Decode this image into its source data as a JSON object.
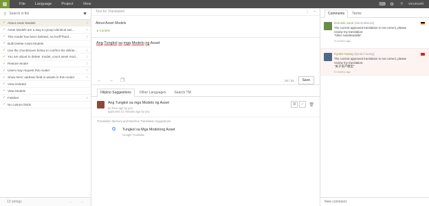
{
  "topbar": {
    "menu": [
      "File",
      "Language",
      "Project",
      "View"
    ],
    "user": "vnrumzett"
  },
  "left": {
    "search_placeholder": "Search in file",
    "strings": [
      {
        "text": "About Asset Models",
        "active": true,
        "comment": true
      },
      {
        "text": "Asset Models are a way to group identical ass...",
        "comment": true
      },
      {
        "text": "This model has been deleted, na hreff\"/hard...",
        "comment": true
      },
      {
        "text": "Bulk Delete Asset Models",
        "comment": false
      },
      {
        "text": "Use the checkboxes below to confirm the delete...",
        "comment": true
      },
      {
        "text": "You are about to delete :model_count asset mod...",
        "comment": true
      },
      {
        "text": "Restore Model",
        "comment": true
      },
      {
        "text": "Users may request this model",
        "comment": true
      },
      {
        "text": "Show MAC address field in assets in this model",
        "comment": true
      },
      {
        "text": "View Deleted",
        "comment": false
      },
      {
        "text": "View Models",
        "comment": false
      },
      {
        "text": "Fieldset",
        "comment": true
      },
      {
        "text": "No custom fields",
        "comment": false
      }
    ],
    "count": "13 strings"
  },
  "center": {
    "source_header": "Text for Translation",
    "source_text": "About Asset Models",
    "context_label": "▸ Context",
    "translation_words": [
      "Ang",
      "Tungkol",
      "sa",
      "mga",
      "Modelo",
      "ng",
      "Asset"
    ],
    "char_count": "18 / 34",
    "save_label": "Save",
    "tabs": [
      "Filipino Suggestions",
      "Other Languages",
      "Search TM"
    ],
    "suggestion": {
      "text": "Ang Tungkol sa mga Modelo ng Asset",
      "meta1": "an hour ago by you",
      "meta2": "approved 21 minutes ago by you",
      "votes": "0"
    },
    "tm_caption": "Translation Memory and Machine Translation suggestions:",
    "tm": {
      "text": "Tungkol sa Mga Modelong Asset",
      "source": "Google Translate"
    }
  },
  "right": {
    "tabs": [
      "Comments",
      "Terms"
    ],
    "comments": [
      {
        "author": "Dominik Senti",
        "handle": "(dominiksenti)",
        "line1": "The current approved translation is not correct, please",
        "line2": "review my translation:",
        "line3": "\"Über AssetModelle\"",
        "time": "5 months ago"
      },
      {
        "author": "Kyodo Huang",
        "handle": "(kyodo.huang)",
        "line1": "The current approved translation is not correct, please",
        "line2": "review my translation:",
        "line3": "\"关于资产模型\"",
        "time": "5 months ago"
      }
    ],
    "new_comment_placeholder": "New comment"
  },
  "colors": {
    "accent": "#7a9a3a",
    "topbar": "#4d4d4d",
    "active_row": "#f2f0e6"
  }
}
